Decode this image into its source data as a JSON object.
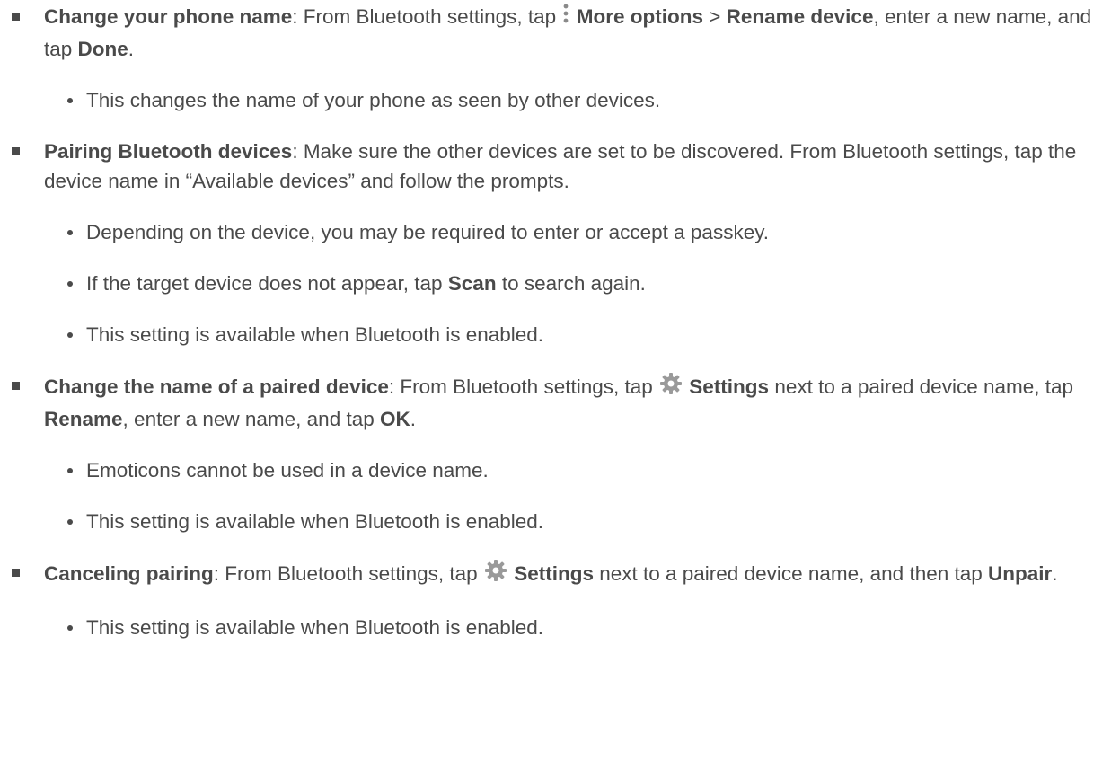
{
  "items": [
    {
      "term": "Change your phone name",
      "t1": ": From Bluetooth settings, tap ",
      "icon": "more-options-icon",
      "b1": "More options",
      "t2": " > ",
      "b2": "Rename device",
      "t3": ", enter a new name, and tap ",
      "b3": "Done",
      "t4": ".",
      "subs": [
        "This changes the name of your phone as seen by other devices."
      ]
    },
    {
      "term": "Pairing Bluetooth devices",
      "t1": ": Make sure the other devices are set to be discovered. From Bluetooth settings, tap the device name in “Available devices” and follow the prompts.",
      "subs": [
        "Depending on the device, you may be required to enter or accept a passkey.",
        "This setting is available when Bluetooth is enabled."
      ],
      "scan_sub": {
        "pre": "If the target device does not appear, tap ",
        "bold": "Scan",
        "post": " to search again."
      }
    },
    {
      "term": "Change the name of a paired device",
      "t1": ": From Bluetooth settings, tap ",
      "icon": "settings-gear-icon",
      "b1": "Settings",
      "t2": " next to a paired device name, tap ",
      "b2": "Rename",
      "t3": ", enter a new name, and tap ",
      "b3": "OK",
      "t4": ".",
      "subs": [
        "Emoticons cannot be used in a device name.",
        "This setting is available when Bluetooth is enabled."
      ]
    },
    {
      "term": "Canceling pairing",
      "t1": ": From Bluetooth settings, tap ",
      "icon": "settings-gear-icon",
      "b1": "Settings",
      "t2": " next to a paired device name, and then tap ",
      "b2": "Unpair",
      "t3": ".",
      "subs": [
        "This setting is available when Bluetooth is enabled."
      ]
    }
  ]
}
